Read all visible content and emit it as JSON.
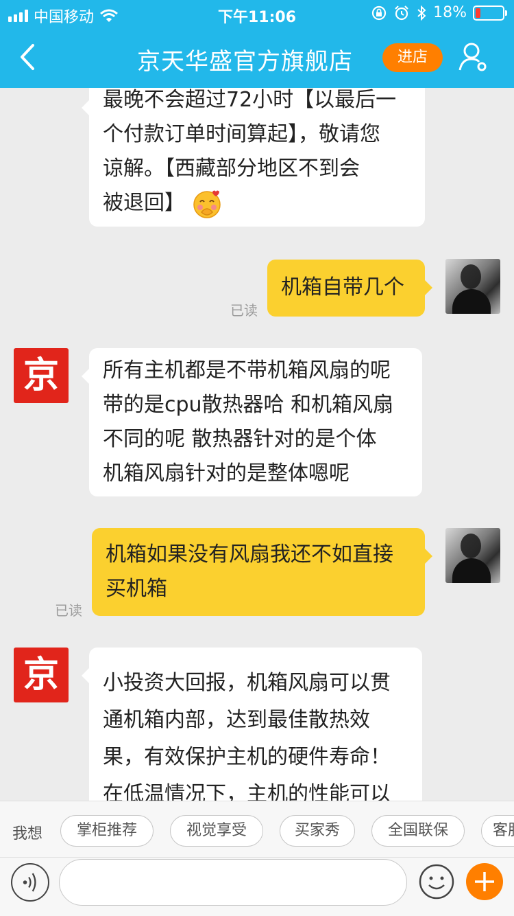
{
  "status_bar": {
    "carrier": "中国移动",
    "time": "下午11:06",
    "battery": "18%",
    "battery_level": 0.18
  },
  "nav": {
    "title": "京天华盛官方旗舰店",
    "enter_store": "进店"
  },
  "messages": [
    {
      "from": "shop",
      "lines": [
        "最晚不会超过72小时【以最后一",
        "个付款订单时间算起】，敬请您",
        "谅解。【西藏部分地区不到会",
        "被退回】"
      ],
      "emoji": "blushing-face"
    },
    {
      "from": "me",
      "lines": [
        "机箱自带几个"
      ],
      "status": "已读"
    },
    {
      "from": "shop",
      "avatar_text": "京",
      "lines": [
        "所有主机都是不带机箱风扇的呢",
        "带的是cpu散热器哈 和机箱风扇",
        "不同的呢 散热器针对的是个体",
        "机箱风扇针对的是整体嗯呢"
      ]
    },
    {
      "from": "me",
      "lines": [
        "机箱如果没有风扇我还不如直接",
        "买机箱"
      ],
      "status": "已读"
    },
    {
      "from": "shop",
      "avatar_text": "京",
      "lines": [
        "小投资大回报，机箱风扇可以贯",
        "通机箱内部，达到最佳散热效",
        "果，有效保护主机的硬件寿命！",
        "在低温情况下，主机的性能可以"
      ]
    }
  ],
  "quick_replies": {
    "label": "我想",
    "items": [
      "掌柜推荐",
      "视觉享受",
      "买家秀",
      "全国联保",
      "客服"
    ]
  },
  "input": {
    "value": "",
    "placeholder": ""
  },
  "colors": {
    "header": "#22b8ea",
    "accent": "#ff7f00",
    "my_bubble": "#fbd02f",
    "shop_avatar": "#e1251b"
  },
  "icons": [
    "signal-icon",
    "wifi-icon",
    "lock-rotation-icon",
    "alarm-icon",
    "bluetooth-icon",
    "battery-icon",
    "back-arrow-icon",
    "user-settings-icon",
    "voice-icon",
    "emoji-icon",
    "plus-icon"
  ]
}
